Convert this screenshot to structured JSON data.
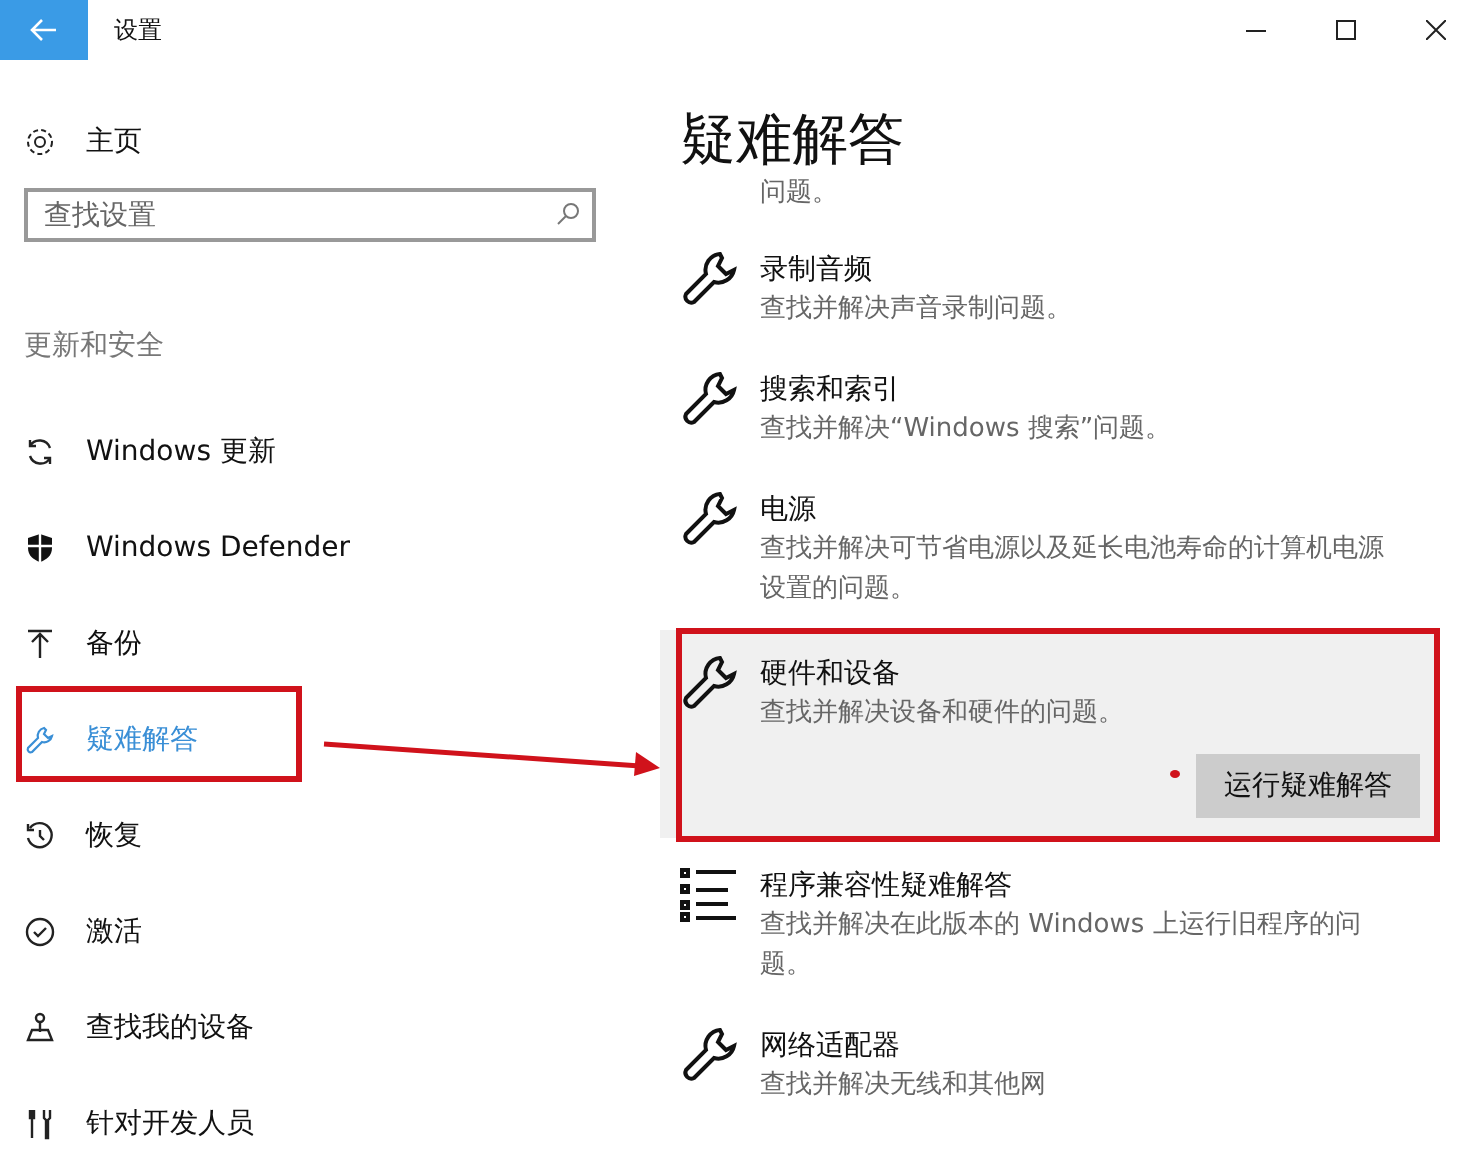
{
  "window": {
    "title": "设置"
  },
  "sidebar": {
    "home": "主页",
    "search": {
      "placeholder": "查找设置"
    },
    "section": "更新和安全",
    "items": [
      {
        "label": "Windows 更新",
        "kind": "update",
        "selected": false
      },
      {
        "label": "Windows Defender",
        "kind": "shield",
        "selected": false
      },
      {
        "label": "备份",
        "kind": "backup",
        "selected": false
      },
      {
        "label": "疑难解答",
        "kind": "wrench",
        "selected": true
      },
      {
        "label": "恢复",
        "kind": "history",
        "selected": false
      },
      {
        "label": "激活",
        "kind": "check",
        "selected": false
      },
      {
        "label": "查找我的设备",
        "kind": "locate",
        "selected": false
      },
      {
        "label": "针对开发人员",
        "kind": "tools",
        "selected": false
      }
    ]
  },
  "content": {
    "heading": "疑难解答",
    "clipped_text": "问题。",
    "troubleshooters": [
      {
        "title": "录制音频",
        "description": "查找并解决声音录制问题。",
        "kind": "wrench",
        "expanded": false
      },
      {
        "title": "搜索和索引",
        "description": "查找并解决“Windows 搜索”问题。",
        "kind": "wrench",
        "expanded": false
      },
      {
        "title": "电源",
        "description": "查找并解决可节省电源以及延长电池寿命的计算机电源设置的问题。",
        "kind": "wrench",
        "expanded": false
      },
      {
        "title": "硬件和设备",
        "description": "查找并解决设备和硬件的问题。",
        "kind": "wrench",
        "expanded": true,
        "button": "运行疑难解答"
      },
      {
        "title": "程序兼容性疑难解答",
        "description": "查找并解决在此版本的 Windows 上运行旧程序的问题。",
        "kind": "list",
        "expanded": false
      },
      {
        "title": "网络适配器",
        "description": "查找并解决无线和其他网",
        "kind": "wrench",
        "expanded": false
      }
    ]
  }
}
